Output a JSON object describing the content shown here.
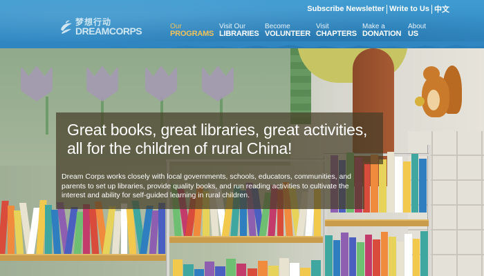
{
  "header": {
    "utility_links": [
      {
        "label": "Subscribe Newsletter"
      },
      {
        "label": "Write to Us"
      },
      {
        "label": "中文"
      }
    ],
    "logo": {
      "cn": "梦想行动",
      "en": "DREAMCORPS"
    },
    "nav": [
      {
        "small": "Our",
        "big": "PROGRAMS",
        "active": true
      },
      {
        "small": "Visit Our",
        "big": "LIBRARIES",
        "active": false
      },
      {
        "small": "Become",
        "big": "VOLUNTEER",
        "active": false
      },
      {
        "small": "Visit",
        "big": "CHAPTERS",
        "active": false
      },
      {
        "small": "Make a",
        "big": "DONATION",
        "active": false
      },
      {
        "small": "About",
        "big": "US",
        "active": false
      }
    ]
  },
  "hero": {
    "headline_line1": "Great books, great libraries, great activities,",
    "headline_line2": "all for the children of rural China!",
    "description": "Dream Corps works closely with local governments, schools, educators, communities, and parents to set up libraries, provide quality books, and run reading activities to cultivate the interest and ability for self-guided learning in rural children."
  },
  "colors": {
    "header_blue": "#3a93c9",
    "nav_active": "#f2c35a",
    "overlay": "#463e28"
  },
  "icons": {
    "logo": "dreamcorps-leaf-logo"
  }
}
